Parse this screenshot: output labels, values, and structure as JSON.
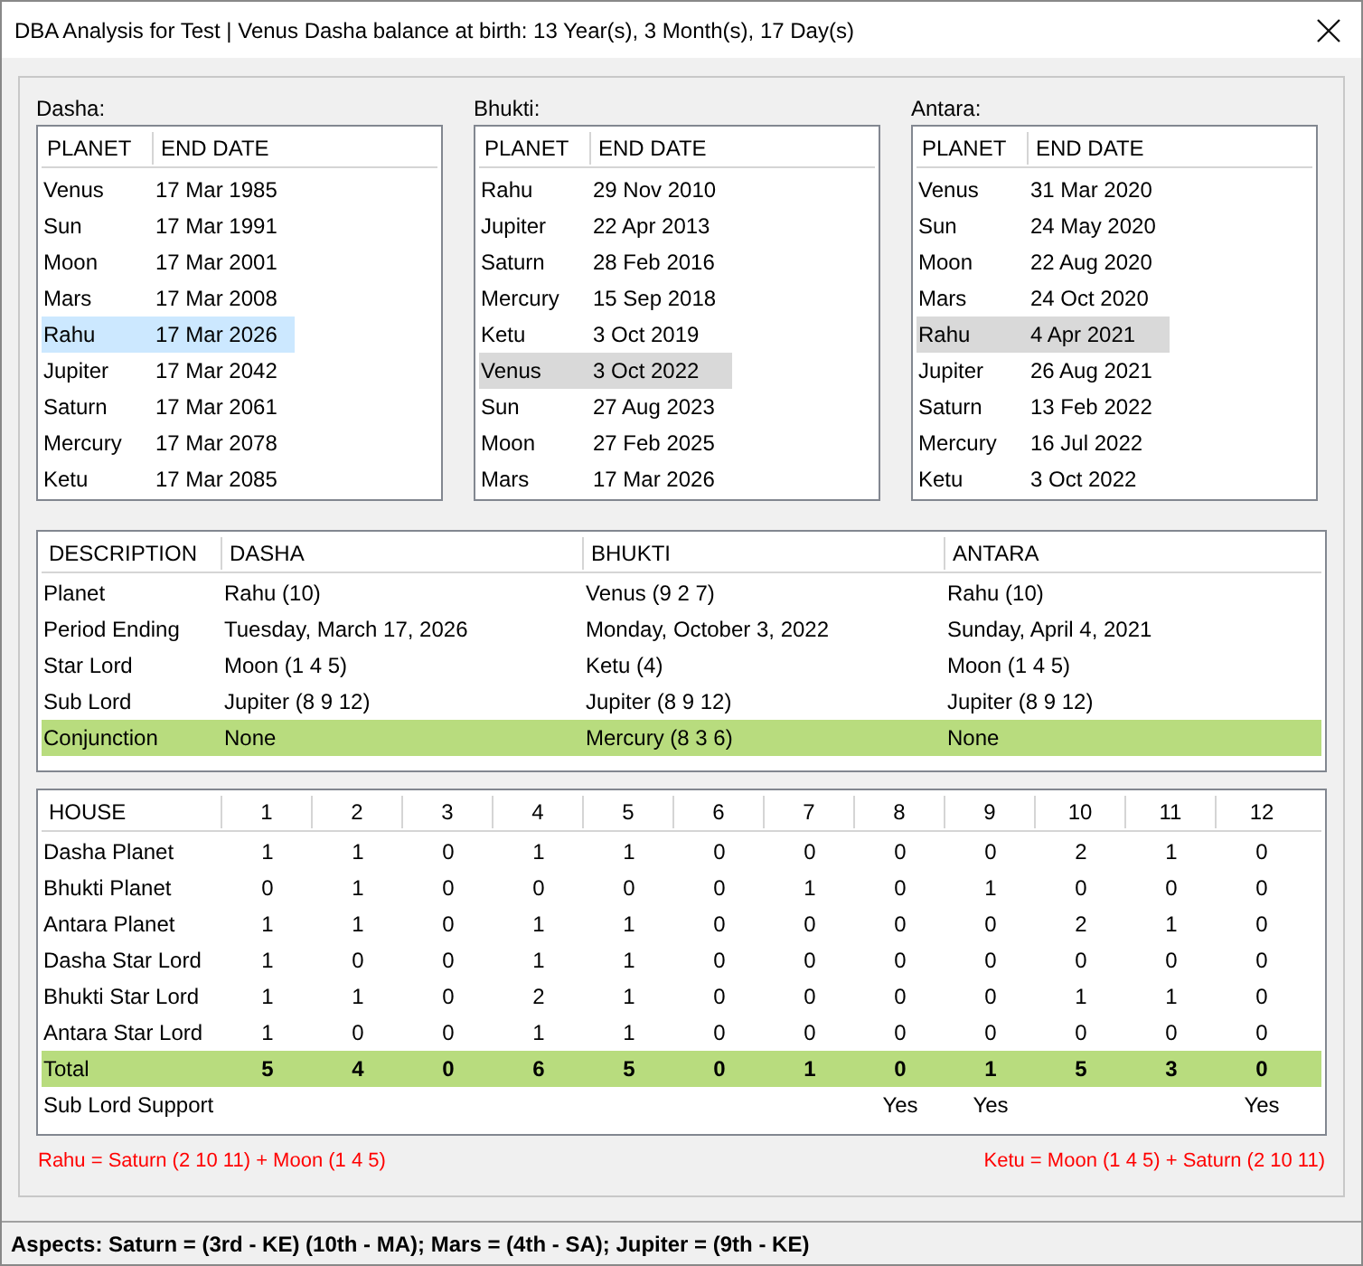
{
  "window": {
    "title": "DBA Analysis for Test | Venus Dasha balance at birth: 13 Year(s), 3 Month(s), 17 Day(s)"
  },
  "lists": [
    {
      "label": "Dasha:",
      "focused": true,
      "columns": [
        "PLANET",
        "END DATE"
      ],
      "rows": [
        {
          "planet": "Venus",
          "end_date": "17 Mar 1985",
          "selected": false
        },
        {
          "planet": "Sun",
          "end_date": "17 Mar 1991",
          "selected": false
        },
        {
          "planet": "Moon",
          "end_date": "17 Mar 2001",
          "selected": false
        },
        {
          "planet": "Mars",
          "end_date": "17 Mar 2008",
          "selected": false
        },
        {
          "planet": "Rahu",
          "end_date": "17 Mar 2026",
          "selected": true
        },
        {
          "planet": "Jupiter",
          "end_date": "17 Mar 2042",
          "selected": false
        },
        {
          "planet": "Saturn",
          "end_date": "17 Mar 2061",
          "selected": false
        },
        {
          "planet": "Mercury",
          "end_date": "17 Mar 2078",
          "selected": false
        },
        {
          "planet": "Ketu",
          "end_date": "17 Mar 2085",
          "selected": false
        }
      ]
    },
    {
      "label": "Bhukti:",
      "focused": false,
      "columns": [
        "PLANET",
        "END DATE"
      ],
      "rows": [
        {
          "planet": "Rahu",
          "end_date": "29 Nov 2010",
          "selected": false
        },
        {
          "planet": "Jupiter",
          "end_date": "22 Apr 2013",
          "selected": false
        },
        {
          "planet": "Saturn",
          "end_date": "28 Feb 2016",
          "selected": false
        },
        {
          "planet": "Mercury",
          "end_date": "15 Sep 2018",
          "selected": false
        },
        {
          "planet": "Ketu",
          "end_date": "3 Oct 2019",
          "selected": false
        },
        {
          "planet": "Venus",
          "end_date": "3 Oct 2022",
          "selected": true
        },
        {
          "planet": "Sun",
          "end_date": "27 Aug 2023",
          "selected": false
        },
        {
          "planet": "Moon",
          "end_date": "27 Feb 2025",
          "selected": false
        },
        {
          "planet": "Mars",
          "end_date": "17 Mar 2026",
          "selected": false
        }
      ]
    },
    {
      "label": "Antara:",
      "focused": false,
      "columns": [
        "PLANET",
        "END DATE"
      ],
      "rows": [
        {
          "planet": "Venus",
          "end_date": "31 Mar 2020",
          "selected": false
        },
        {
          "planet": "Sun",
          "end_date": "24 May 2020",
          "selected": false
        },
        {
          "planet": "Moon",
          "end_date": "22 Aug 2020",
          "selected": false
        },
        {
          "planet": "Mars",
          "end_date": "24 Oct 2020",
          "selected": false
        },
        {
          "planet": "Rahu",
          "end_date": "4 Apr 2021",
          "selected": true
        },
        {
          "planet": "Jupiter",
          "end_date": "26 Aug 2021",
          "selected": false
        },
        {
          "planet": "Saturn",
          "end_date": "13 Feb 2022",
          "selected": false
        },
        {
          "planet": "Mercury",
          "end_date": "16 Jul 2022",
          "selected": false
        },
        {
          "planet": "Ketu",
          "end_date": "3 Oct 2022",
          "selected": false
        }
      ]
    }
  ],
  "description_table": {
    "columns": [
      "DESCRIPTION",
      "DASHA",
      "BHUKTI",
      "ANTARA"
    ],
    "rows": [
      {
        "cells": [
          "Planet",
          "Rahu (10)",
          "Venus (9 2 7)",
          "Rahu (10)"
        ],
        "highlighted": false
      },
      {
        "cells": [
          "Period Ending",
          "Tuesday, March 17, 2026",
          "Monday, October 3, 2022",
          "Sunday, April 4, 2021"
        ],
        "highlighted": false
      },
      {
        "cells": [
          "Star Lord",
          "Moon (1 4 5)",
          "Ketu (4)",
          "Moon (1 4 5)"
        ],
        "highlighted": false
      },
      {
        "cells": [
          "Sub Lord",
          "Jupiter (8 9 12)",
          "Jupiter (8 9 12)",
          "Jupiter (8 9 12)"
        ],
        "highlighted": false
      },
      {
        "cells": [
          "Conjunction",
          "None",
          "Mercury (8 3 6)",
          "None"
        ],
        "highlighted": true
      }
    ]
  },
  "house_table": {
    "columns": [
      "HOUSE",
      "1",
      "2",
      "3",
      "4",
      "5",
      "6",
      "7",
      "8",
      "9",
      "10",
      "11",
      "12"
    ],
    "rows": [
      {
        "cells": [
          "Dasha Planet",
          "1",
          "1",
          "0",
          "1",
          "1",
          "0",
          "0",
          "0",
          "0",
          "2",
          "1",
          "0"
        ],
        "highlighted": false
      },
      {
        "cells": [
          "Bhukti Planet",
          "0",
          "1",
          "0",
          "0",
          "0",
          "0",
          "1",
          "0",
          "1",
          "0",
          "0",
          "0"
        ],
        "highlighted": false
      },
      {
        "cells": [
          "Antara Planet",
          "1",
          "1",
          "0",
          "1",
          "1",
          "0",
          "0",
          "0",
          "0",
          "2",
          "1",
          "0"
        ],
        "highlighted": false
      },
      {
        "cells": [
          "Dasha Star Lord",
          "1",
          "0",
          "0",
          "1",
          "1",
          "0",
          "0",
          "0",
          "0",
          "0",
          "0",
          "0"
        ],
        "highlighted": false
      },
      {
        "cells": [
          "Bhukti Star Lord",
          "1",
          "1",
          "0",
          "2",
          "1",
          "0",
          "0",
          "0",
          "0",
          "1",
          "1",
          "0"
        ],
        "highlighted": false
      },
      {
        "cells": [
          "Antara Star Lord",
          "1",
          "0",
          "0",
          "1",
          "1",
          "0",
          "0",
          "0",
          "0",
          "0",
          "0",
          "0"
        ],
        "highlighted": false
      },
      {
        "cells": [
          "Total",
          "5",
          "4",
          "0",
          "6",
          "5",
          "0",
          "1",
          "0",
          "1",
          "5",
          "3",
          "0"
        ],
        "highlighted": true
      },
      {
        "cells": [
          "Sub Lord Support",
          "",
          "",
          "",
          "",
          "",
          "",
          "",
          "Yes",
          "Yes",
          "",
          "",
          "Yes"
        ],
        "highlighted": false
      }
    ]
  },
  "notes": [
    "Rahu = Saturn (2 10 11) + Moon (1 4 5)",
    "Ketu = Moon (1 4 5) + Saturn (2 10 11)"
  ],
  "status_bar": "Aspects: Saturn = (3rd - KE) (10th - MA); Mars = (4th - SA); Jupiter = (9th - KE)"
}
